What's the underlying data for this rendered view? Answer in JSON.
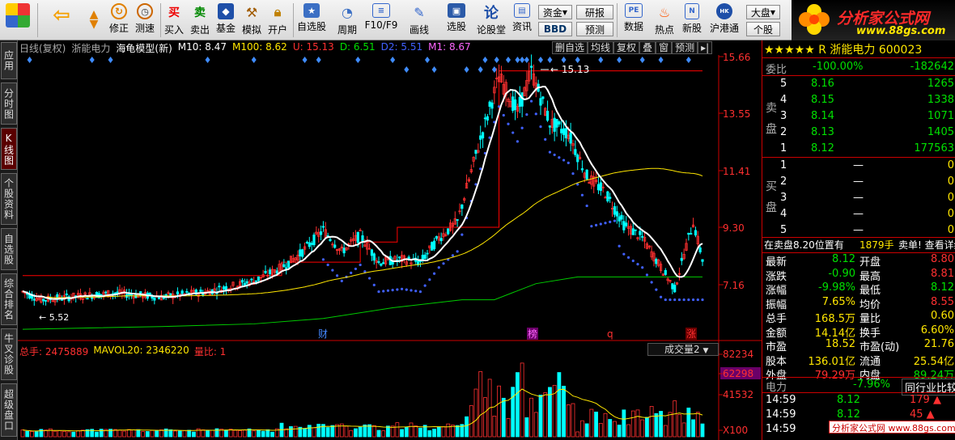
{
  "toolbar": {
    "buttons": [
      {
        "label": "",
        "icon": "grid-icon"
      },
      {
        "label": "",
        "icon": "back-arrow-icon"
      },
      {
        "label": "",
        "icon": "up-down-arrows-icon"
      },
      {
        "label": "修正",
        "icon": "correct-icon"
      },
      {
        "label": "测速",
        "icon": "clock-icon"
      },
      {
        "label": "买入",
        "icon": "buy-icon"
      },
      {
        "label": "卖出",
        "icon": "sell-icon"
      },
      {
        "label": "基金",
        "icon": "fund-icon"
      },
      {
        "label": "模拟",
        "icon": "hammer-icon"
      },
      {
        "label": "开户",
        "icon": "lock-icon"
      },
      {
        "label": "自选股",
        "icon": "favorites-icon"
      },
      {
        "label": "周期",
        "icon": "period-icon"
      },
      {
        "label": "F10/F9",
        "icon": "f10-icon"
      },
      {
        "label": "画线",
        "icon": "pen-icon"
      },
      {
        "label": "选股",
        "icon": "screen-icon"
      },
      {
        "label": "论股堂",
        "icon": "forum-icon"
      },
      {
        "label": "资讯",
        "icon": "info-icon"
      },
      {
        "label": "数据",
        "icon": "pe-icon"
      },
      {
        "label": "热点",
        "icon": "hot-icon"
      },
      {
        "label": "新股",
        "icon": "new-stock-icon"
      },
      {
        "label": "沪港通",
        "icon": "hk-icon"
      }
    ],
    "zijin": "资金",
    "bbd": "BBD",
    "yanbao": "研报",
    "yuce": "预测",
    "dapan": "大盘",
    "gegu": "个股"
  },
  "logo": {
    "title": "分析家公式网",
    "url": "www.88gs.com"
  },
  "left_tabs": [
    "应用",
    "分时图",
    "K线图",
    "个股资料",
    "自选股",
    "综合排名",
    "牛叉诊股",
    "超级盘口"
  ],
  "chart_header": {
    "period": "日线(复权)",
    "stock": "浙能电力",
    "model": "海龟模型(新)",
    "m10": "M10: 8.47",
    "m100": "M100: 8.62",
    "u": "U: 15.13",
    "d": "D: 6.51",
    "d2": "D2: 5.51",
    "m1": "M1: 8.67"
  },
  "chart_tabs": [
    "删自选",
    "均线",
    "复权",
    "叠",
    "窗",
    "预测"
  ],
  "price_axis": [
    "15.66",
    "13.55",
    "11.41",
    "9.30",
    "7.16"
  ],
  "marks": {
    "high": "15.13",
    "low": "5.52",
    "events": [
      "财",
      "榜",
      "q",
      "涨"
    ]
  },
  "volume_header": {
    "total": "总手: 2475889",
    "mavol20": "MAVOL20: 2346220",
    "ratio": "量比: 1",
    "selector": "成交量2"
  },
  "volume_axis": [
    "82234",
    "62298",
    "41532",
    "X100"
  ],
  "right_panel": {
    "star_name": "★★★★★ R 浙能电力 600023",
    "weibi": {
      "label": "委比",
      "pct": "-100.00%",
      "val": "-182642"
    },
    "sell_label": "卖盘",
    "buy_label": "买盘",
    "sell": [
      [
        "5",
        "8.16",
        "1265"
      ],
      [
        "4",
        "8.15",
        "1338"
      ],
      [
        "3",
        "8.14",
        "1071"
      ],
      [
        "2",
        "8.13",
        "1405"
      ],
      [
        "1",
        "8.12",
        "177563"
      ]
    ],
    "buy": [
      [
        "1",
        "—",
        "0"
      ],
      [
        "2",
        "—",
        "0"
      ],
      [
        "3",
        "—",
        "0"
      ],
      [
        "4",
        "—",
        "0"
      ],
      [
        "5",
        "—",
        "0"
      ]
    ],
    "status": {
      "left": "在卖盘8.20位置有",
      "mid": "1879手",
      "right": "卖单! 查看详细"
    },
    "quote": [
      [
        "最新",
        "8.12",
        "开盘",
        "8.80"
      ],
      [
        "涨跌",
        "-0.90",
        "最高",
        "8.81"
      ],
      [
        "涨幅",
        "-9.98%",
        "最低",
        "8.12"
      ],
      [
        "振幅",
        "7.65%",
        "均价",
        "8.55"
      ],
      [
        "总手",
        "168.5万",
        "量比",
        "0.60"
      ],
      [
        "金额",
        "14.14亿",
        "换手",
        "6.60%"
      ],
      [
        "市盈",
        "18.52",
        "市盈(动)",
        "21.76"
      ],
      [
        "股本",
        "136.01亿",
        "流通",
        "25.54亿"
      ],
      [
        "外盘",
        "79.29万",
        "内盘",
        "89.24万"
      ]
    ],
    "industry": {
      "name": "电力",
      "pct": "-7.96%",
      "compare": "同行业比较"
    },
    "ticks": [
      [
        "14:59",
        "8.12",
        "179"
      ],
      [
        "14:59",
        "8.12",
        "45"
      ],
      [
        "14:59",
        "8.12",
        ""
      ]
    ],
    "watermark": "分析家公式网 www.88gs.com"
  },
  "colors": {
    "up": "#ff3030",
    "down": "#00ffff",
    "ma_white": "#ffffff",
    "ma_yellow": "#ffe600",
    "red_line": "#ff0000",
    "green_line": "#00cc00",
    "blue_dots": "#4060ff"
  }
}
